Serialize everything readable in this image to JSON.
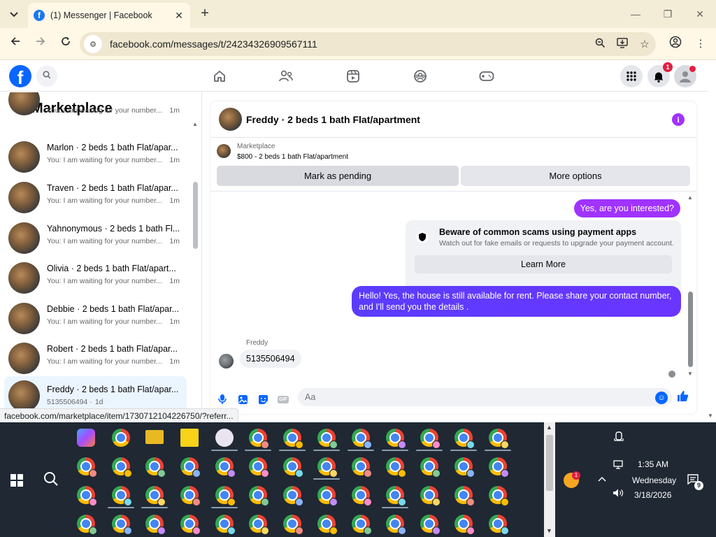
{
  "browser": {
    "tab_title": "(1) Messenger | Facebook",
    "url": "facebook.com/messages/t/24234326909567111",
    "status_url": "facebook.com/marketplace/item/1730712104226750/?referr..."
  },
  "fb": {
    "notifications_count": "1",
    "logo_letter": "f"
  },
  "left_panel": {
    "title": "Marketplace",
    "partial_preview": "You: I am waiting for your number...",
    "partial_time": "1m",
    "conversations": [
      {
        "name": "Marlon · 2 beds 1 bath Flat/apar...",
        "preview": "You: I am waiting for your number...",
        "time": "1m",
        "active": false
      },
      {
        "name": "Traven · 2 beds 1 bath Flat/apar...",
        "preview": "You: I am waiting for your number...",
        "time": "1m",
        "active": false
      },
      {
        "name": "Yahnonymous · 2 beds 1 bath Fl...",
        "preview": "You: I am waiting for your number...",
        "time": "1m",
        "active": false
      },
      {
        "name": "Olivia · 2 beds 1 bath Flat/apart...",
        "preview": "You: I am waiting for your number...",
        "time": "1m",
        "active": false
      },
      {
        "name": "Debbie · 2 beds 1 bath Flat/apar...",
        "preview": "You: I am waiting for your number...",
        "time": "1m",
        "active": false
      },
      {
        "name": "Robert · 2 beds 1 bath Flat/apar...",
        "preview": "You: I am waiting for your number...",
        "time": "1m",
        "active": false
      },
      {
        "name": "Freddy · 2 beds 1 bath Flat/apar...",
        "preview": "5135506494 ·",
        "time": "1d",
        "active": true
      }
    ]
  },
  "chat": {
    "title": "Freddy · 2 beds 1 bath Flat/apartment",
    "marketplace_label": "Marketplace",
    "item_text": "$800 - 2 beds 1 bath Flat/apartment",
    "mark_pending": "Mark as pending",
    "more_options": "More options",
    "messages": {
      "outgoing_1": "Yes, are you interested?",
      "scam_title": "Beware of common scams using payment apps",
      "scam_sub": "Watch out for fake emails or requests to upgrade your payment account.",
      "learn_more": "Learn More",
      "outgoing_2": "Hello! Yes, the house is still available for rent. Please share your contact number, and I'll send you the details .",
      "sender_name": "Freddy",
      "incoming_1": "5135506494"
    },
    "composer_placeholder": "Aa",
    "gif_label": "GIF"
  },
  "taskbar": {
    "time": "1:35 AM",
    "day": "Wednesday",
    "date": "3/18/2026",
    "notification_count": "9",
    "moon_badge": "1"
  }
}
